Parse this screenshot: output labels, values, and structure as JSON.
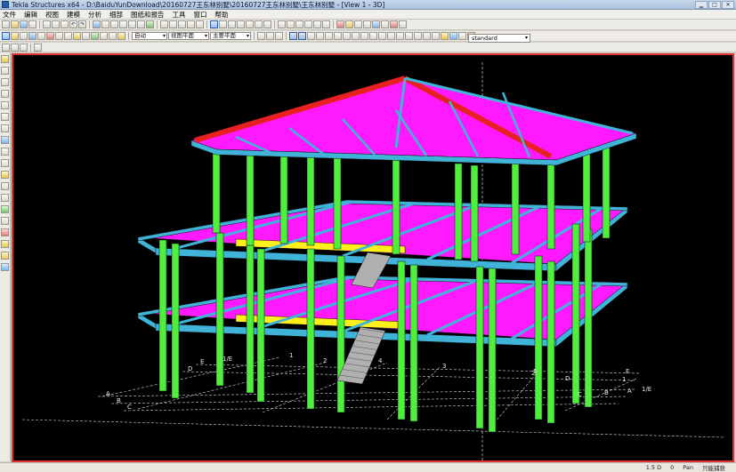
{
  "window": {
    "title": "Tekla Structures x64 - D:\\BaiduYunDownload\\20160727王东林别墅\\20160727王东林别墅\\王东林别墅 - [View 1 - 3D]"
  },
  "menu": [
    "文件",
    "编辑",
    "视图",
    "建模",
    "分析",
    "细部",
    "图纸和报告",
    "工具",
    "窗口",
    "帮助"
  ],
  "toolbar": {
    "snap_mode": "自动",
    "view_plane": "视图平面",
    "work_plane": "主要平面",
    "settings_select": "standard"
  },
  "model": {
    "grid_labels": {
      "left_letters": [
        "A",
        "B",
        "C",
        "D",
        "E"
      ],
      "front_numbers": [
        "1",
        "2",
        "3",
        "4",
        "5"
      ],
      "right_letters": [
        "A",
        "B",
        "C",
        "D",
        "E"
      ],
      "right_numbers": [
        "1",
        "2"
      ],
      "fraction_left": "1/E",
      "fraction_right": "1/E"
    },
    "colors": {
      "column": "#4ef03a",
      "beam": "#3fb4d8",
      "slab": "#ff19ff",
      "highlight_beam": "#ffef1a",
      "roof_ridge": "#e82020",
      "stair": "#b0b0b0",
      "grid": "#d9d9d9",
      "frame": "#e23030"
    }
  },
  "status": {
    "scale": "1.5 D",
    "value": "0",
    "unit": "Pan",
    "mode": "只能捕获"
  }
}
